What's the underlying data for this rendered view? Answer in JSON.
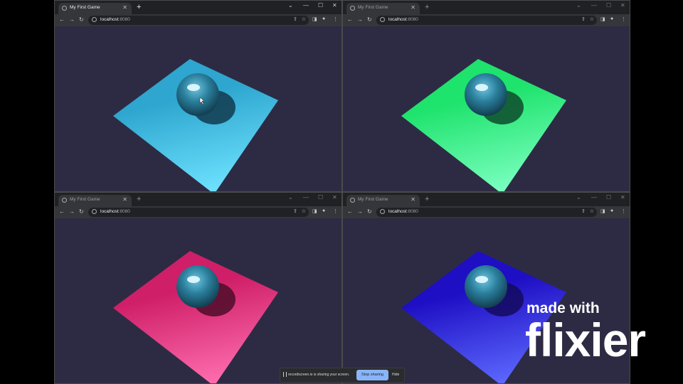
{
  "windows": [
    {
      "tab_title": "My First Game",
      "url_host": "localhost",
      "url_port": ":8080",
      "plane_color": "#2ea6cf",
      "plane_light": "#6fe3ff"
    },
    {
      "tab_title": "My First Game",
      "url_host": "localhost",
      "url_port": ":8080",
      "plane_color": "#1ee36c",
      "plane_light": "#7dffc2"
    },
    {
      "tab_title": "My First Game",
      "url_host": "localhost",
      "url_port": ":8080",
      "plane_color": "#cf1f68",
      "plane_light": "#ff6fb0"
    },
    {
      "tab_title": "My First Game",
      "url_host": "localhost",
      "url_port": ":8080",
      "plane_color": "#1e0ec4",
      "plane_light": "#5d6aff"
    }
  ],
  "share_bar": {
    "message": "recordscreen.io is sharing your screen.",
    "stop_label": "Stop sharing",
    "hide_label": "Hide"
  },
  "watermark": {
    "line1": "made with",
    "line2": "flixier"
  },
  "icons": {
    "favicon": "globe-icon",
    "info": "info-icon",
    "share": "share-icon",
    "star": "star-icon",
    "sidepanel": "side-panel-icon",
    "profile": "profile-icon",
    "menu": "kebab-menu-icon",
    "pause": "pause-icon"
  },
  "colors": {
    "scene_bg": "#2d2b44",
    "ball": "#2a7f9c",
    "stop_button": "#8ab4f8"
  }
}
